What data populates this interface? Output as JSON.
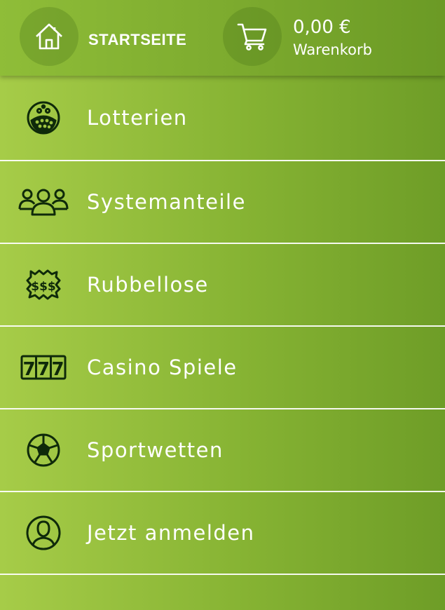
{
  "header": {
    "home_label": "STARTSEITE",
    "home_icon": "home-icon",
    "cart_amount": "0,00 €",
    "cart_label": "Warenkorb",
    "cart_icon": "shopping-cart-icon"
  },
  "menu": {
    "items": [
      {
        "label": "Lotterien",
        "icon": "lottery-balls-icon"
      },
      {
        "label": "Systemanteile",
        "icon": "group-people-icon"
      },
      {
        "label": "Rubbellose",
        "icon": "scratch-card-icon"
      },
      {
        "label": "Casino Spiele",
        "icon": "slot-machine-777-icon"
      },
      {
        "label": "Sportwetten",
        "icon": "soccer-ball-icon"
      },
      {
        "label": "Jetzt anmelden",
        "icon": "user-profile-icon"
      }
    ]
  },
  "colors": {
    "gradient_left": "#a6cc48",
    "gradient_right": "#6e9d27",
    "icon_dark": "#0f2a0a",
    "text": "#ffffff"
  }
}
